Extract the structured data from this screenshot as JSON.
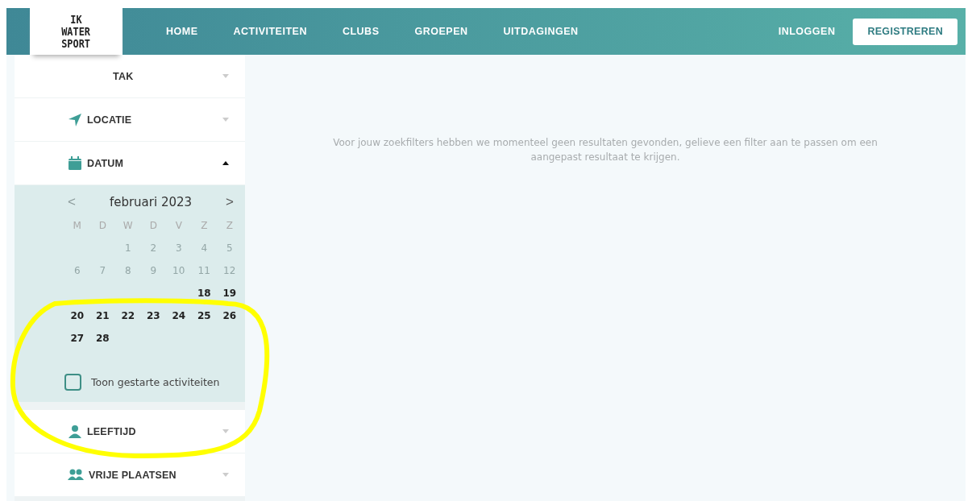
{
  "header": {
    "logo_lines": [
      "IK",
      "WATER",
      "SPORT"
    ],
    "nav": [
      {
        "label": "HOME"
      },
      {
        "label": "ACTIVITEITEN"
      },
      {
        "label": "CLUBS"
      },
      {
        "label": "GROEPEN"
      },
      {
        "label": "UITDAGINGEN"
      }
    ],
    "login": "INLOGGEN",
    "register": "REGISTREREN"
  },
  "filters": [
    {
      "kind": "tak",
      "label": "TAK",
      "expanded": false
    },
    {
      "kind": "location",
      "label": "LOCATIE",
      "expanded": false
    },
    {
      "kind": "date",
      "label": "DATUM",
      "expanded": true
    },
    {
      "kind": "age",
      "label": "LEEFTIJD",
      "expanded": false
    },
    {
      "kind": "places",
      "label": "VRIJE PLAATSEN",
      "expanded": false
    }
  ],
  "calendar": {
    "prev": "<",
    "month": "februari 2023",
    "next": ">",
    "weekdays": [
      "M",
      "D",
      "W",
      "D",
      "V",
      "Z",
      "Z"
    ],
    "weeks": [
      [
        {
          "kind": "empty"
        },
        {
          "kind": "empty"
        },
        {
          "label": "1",
          "disabled": true
        },
        {
          "label": "2",
          "disabled": true
        },
        {
          "label": "3",
          "disabled": true
        },
        {
          "label": "4",
          "disabled": true
        },
        {
          "label": "5",
          "disabled": true
        }
      ],
      [
        {
          "label": "6",
          "disabled": true
        },
        {
          "label": "7",
          "disabled": true
        },
        {
          "label": "8",
          "disabled": true
        },
        {
          "label": "9",
          "disabled": true
        },
        {
          "label": "10",
          "disabled": true
        },
        {
          "label": "11",
          "disabled": true
        },
        {
          "label": "12",
          "disabled": true
        }
      ],
      [
        {
          "kind": "empty"
        },
        {
          "kind": "empty"
        },
        {
          "kind": "empty"
        },
        {
          "kind": "empty"
        },
        {
          "kind": "empty"
        },
        {
          "label": "18",
          "disabled": false
        },
        {
          "label": "19",
          "disabled": false
        }
      ],
      [
        {
          "label": "20",
          "disabled": false
        },
        {
          "label": "21",
          "disabled": false
        },
        {
          "label": "22",
          "disabled": false
        },
        {
          "label": "23",
          "disabled": false
        },
        {
          "label": "24",
          "disabled": false
        },
        {
          "label": "25",
          "disabled": false
        },
        {
          "label": "26",
          "disabled": false
        }
      ],
      [
        {
          "label": "27",
          "disabled": false
        },
        {
          "label": "28",
          "disabled": false
        },
        {
          "kind": "empty"
        },
        {
          "kind": "empty"
        },
        {
          "kind": "empty"
        },
        {
          "kind": "empty"
        },
        {
          "kind": "empty"
        }
      ]
    ],
    "show_started": {
      "label": "Toon gestarte activiteiten",
      "checked": false
    }
  },
  "message": "Voor jouw zoekfilters hebben we momenteel geen resultaten gevonden, gelieve een filter aan te passen om een aangepast resultaat te krijgen.",
  "annotation": {
    "kind": "ellipse"
  }
}
